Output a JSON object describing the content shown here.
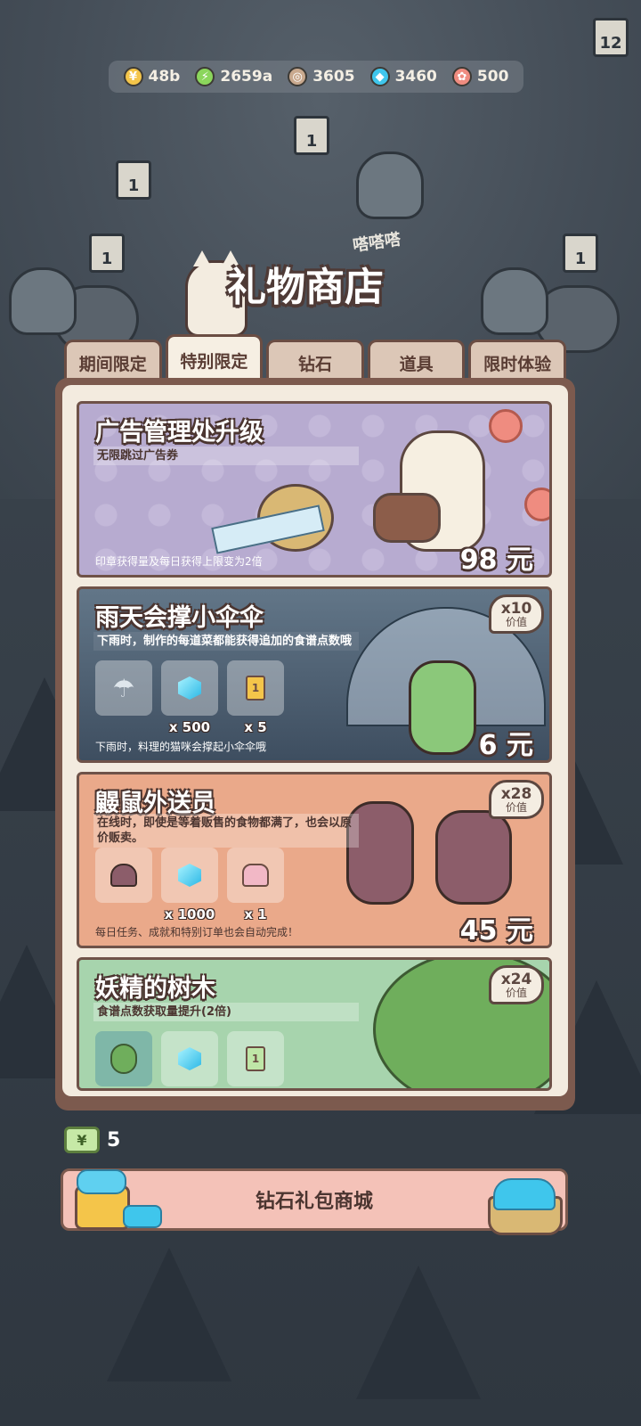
{
  "currencies": [
    {
      "name": "coin-icon",
      "value": "48b",
      "color": "#f4c54a"
    },
    {
      "name": "energy-icon",
      "value": "2659a",
      "color": "#8bd65c"
    },
    {
      "name": "stamp-icon",
      "value": "3605",
      "color": "#c9a98e"
    },
    {
      "name": "diamond-icon",
      "value": "3460",
      "color": "#3fc6ec"
    },
    {
      "name": "recipe-point-icon",
      "value": "500",
      "color": "#ef8c80"
    }
  ],
  "background": {
    "signs": [
      "1",
      "1",
      "1",
      "1",
      "12"
    ],
    "sound_text": "嗒嗒嗒"
  },
  "shop": {
    "title": "礼物商店",
    "tabs": [
      "期间限定",
      "特别限定",
      "钻石",
      "道具",
      "限时体验"
    ],
    "active_tab": "特别限定"
  },
  "offers": [
    {
      "title": "广告管理处升级",
      "subtitle": "无限跳过广告券",
      "footer": "印章获得量及每日获得上限变为2倍",
      "price": "98 元",
      "bg": "#b7abd0"
    },
    {
      "title": "雨天会撑小伞伞",
      "subtitle": "下雨时，制作的每道菜都能获得追加的食谱点数哦",
      "footer": "下雨时，料理的猫咪会撑起小伞伞哦",
      "price": "6 元",
      "badge_mul": "x10",
      "badge_val": "价值",
      "items": [
        {
          "icon": "umbrella-icon",
          "qty": ""
        },
        {
          "icon": "diamond-icon",
          "qty": "x 500"
        },
        {
          "icon": "ticket-icon",
          "qty": "x 5"
        }
      ],
      "bg": "#5d7183"
    },
    {
      "title": "鼹鼠外送员",
      "subtitle": "在线时，即使是等着贩售的食物都满了，也会以原价贩卖。",
      "footer": "每日任务、成就和特别订单也会自动完成！",
      "price": "45 元",
      "badge_mul": "x28",
      "badge_val": "价值",
      "items": [
        {
          "icon": "mole-icon",
          "qty": ""
        },
        {
          "icon": "diamond-icon",
          "qty": "x 1000"
        },
        {
          "icon": "cake-icon",
          "qty": "x 1"
        }
      ],
      "bg": "#eaa98a"
    },
    {
      "title": "妖精的树木",
      "subtitle": "食谱点数获取量提升(2倍)",
      "badge_mul": "x24",
      "badge_val": "价值",
      "bg": "#a7d4ad"
    }
  ],
  "wallet": {
    "currency_symbol": "¥",
    "amount": "5"
  },
  "diamond_mall_button": "钻石礼包商城"
}
